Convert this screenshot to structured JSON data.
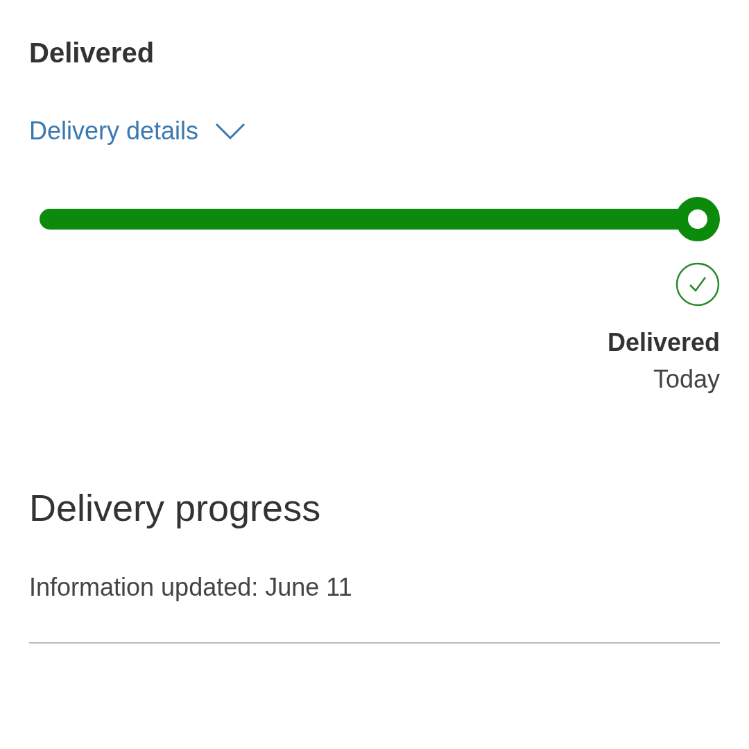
{
  "header": {
    "title": "Delivered"
  },
  "details_link": {
    "label": "Delivery details",
    "expanded": false
  },
  "progress": {
    "level": 1,
    "status": "Delivered",
    "when": "Today"
  },
  "delivery_progress": {
    "heading": "Delivery progress",
    "updated": "Information updated: June 11"
  }
}
